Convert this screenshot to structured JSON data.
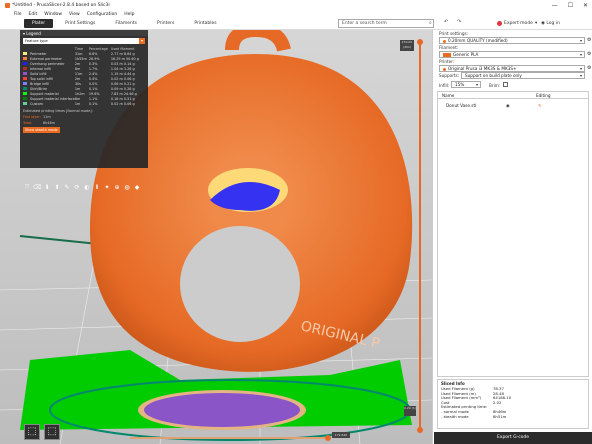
{
  "window": {
    "title": "*Untitled - PrusaSlicer-2.8.4 based on Slic3r",
    "min": "—",
    "max": "☐",
    "close": "✕"
  },
  "menu": [
    "File",
    "Edit",
    "Window",
    "View",
    "Configuration",
    "Help"
  ],
  "tabs": [
    "Plater",
    "Print Settings",
    "Filaments",
    "Printers",
    "Printables"
  ],
  "search": {
    "placeholder": "Enter a search term"
  },
  "mode": "Expert mode",
  "login": "Log in",
  "legend": {
    "header": "Legend",
    "view_type": "Feature type",
    "columns": [
      "",
      "Time",
      "Percentage",
      "Used filament"
    ],
    "rows": [
      {
        "name": "Perimeter",
        "color": "#ffe680",
        "time": "31m",
        "pct": "6.8%",
        "fil": "2.77 m  8.64 g"
      },
      {
        "name": "External perimeter",
        "color": "#ff7d38",
        "time": "1h55m",
        "pct": "26.9%",
        "fil": "16.29 m  50.60 g"
      },
      {
        "name": "Overhang perimeter",
        "color": "#1f1fff",
        "time": "2m",
        "pct": "0.3%",
        "fil": "0.03 m  0.14 g"
      },
      {
        "name": "Internal infill",
        "color": "#b03029",
        "time": "8m",
        "pct": "1.7%",
        "fil": "1.04 m  3.26 g"
      },
      {
        "name": "Solid infill",
        "color": "#9654cc",
        "time": "11m",
        "pct": "2.4%",
        "fil": "1.15 m  4.44 g"
      },
      {
        "name": "Top solid infill",
        "color": "#f04040",
        "time": "2m",
        "pct": "0.4%",
        "fil": "0.02 m  0.06 g"
      },
      {
        "name": "Bridge infill",
        "color": "#7d7dff",
        "time": "30s",
        "pct": "0.0%",
        "fil": "0.06 m  0.21 g"
      },
      {
        "name": "Skirt/Brim",
        "color": "#00876e",
        "time": "1m",
        "pct": "0.1%",
        "fil": "0.09 m  0.28 g"
      },
      {
        "name": "Support material",
        "color": "#00ff00",
        "time": "1h2m",
        "pct": "19.6%",
        "fil": "7.83 m  24.46 g"
      },
      {
        "name": "Support material interface",
        "color": "#008000",
        "time": "8m",
        "pct": "1.1%",
        "fil": "0.16 m  0.51 g"
      },
      {
        "name": "Custom",
        "color": "#5ed194",
        "time": "1m",
        "pct": "0.1%",
        "fil": "0.02 m  0.06 g"
      }
    ],
    "estimated_label": "Estimated printing times [Normal mode]:",
    "first_layer_label": "First layer:",
    "first_layer": "11m",
    "total_label": "Total:",
    "total": "8h46m",
    "stealth_button": "Show stealth mode"
  },
  "sliders": {
    "top": "150.00\n(301)",
    "bottom": "0.20\n(1)",
    "h": "172.640"
  },
  "sidebar": {
    "print_settings_label": "Print settings:",
    "print_settings": "0.20mm QUALITY (modified)",
    "filament_label": "Filament:",
    "filament": "Generic PLA",
    "printer_label": "Printer:",
    "printer": "Original Prusa i3 MK3S & MK3S+",
    "supports_label": "Supports:",
    "supports": "Support on build plate only",
    "infill_label": "Infill:",
    "infill": "15%",
    "brim_label": "Brim:",
    "list_headers": [
      "Name",
      "Editing"
    ],
    "object_name": "Donut Vase.stl"
  },
  "sliced": {
    "title": "Sliced Info",
    "rows": [
      {
        "k": "Used Filament (g)",
        "v": "78.37"
      },
      {
        "k": "Used Filament (m)",
        "v": "28.48"
      },
      {
        "k": "Used Filament (mm³)",
        "v": "64188.10"
      },
      {
        "k": "Cost",
        "v": "2.02"
      },
      {
        "k": "Estimated printing time:",
        "v": ""
      },
      {
        "k": "  - normal mode",
        "v": "8h46m"
      },
      {
        "k": "  - stealth mode",
        "v": "8h51m"
      }
    ]
  },
  "export_button": "Export G-code"
}
